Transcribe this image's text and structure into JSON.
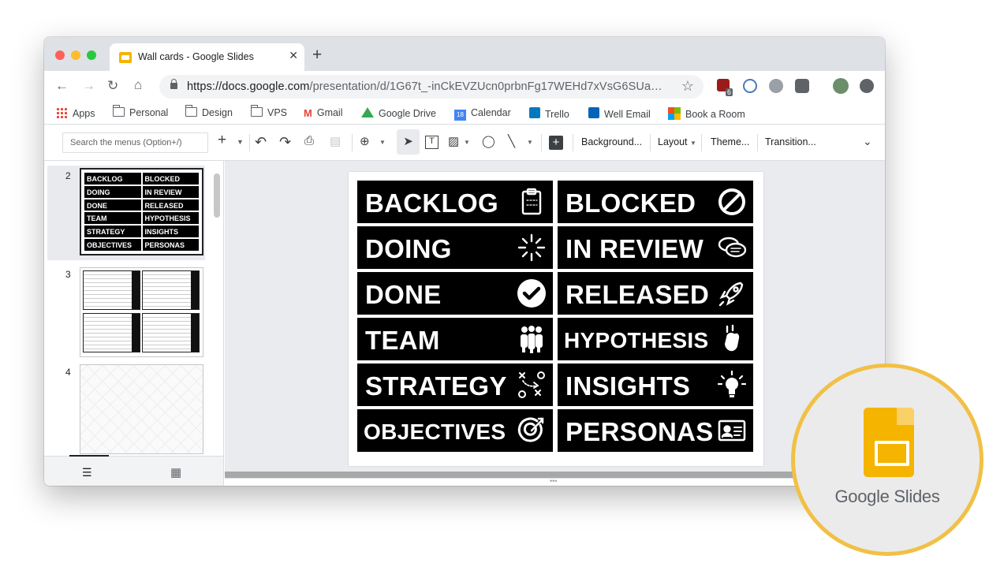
{
  "browser": {
    "tab_title": "Wall cards - Google Slides",
    "tab_close": "✕",
    "new_tab": "+",
    "url_host": "https://docs.google.com",
    "url_path": "/presentation/d/1G67t_-inCkEVZUcn0prbnFg17WEHd7xVsG6SUa…",
    "ext_badge": "6",
    "bookmarks": [
      "Apps",
      "Personal",
      "Design",
      "VPS",
      "Gmail",
      "Google Drive",
      "Calendar",
      "Trello",
      "Well Email",
      "Book a Room"
    ],
    "calendar_day": "18"
  },
  "slides_toolbar": {
    "search_menus": "Search the menus (Option+/)",
    "background": "Background...",
    "layout": "Layout",
    "theme": "Theme...",
    "transition": "Transition..."
  },
  "filmstrip": {
    "slide_numbers": [
      "2",
      "3",
      "4"
    ],
    "slide2_cards": [
      "BACKLOG",
      "BLOCKED",
      "DOING",
      "IN REVIEW",
      "DONE",
      "RELEASED",
      "TEAM",
      "HYPOTHESIS",
      "STRATEGY",
      "INSIGHTS",
      "OBJECTIVES",
      "PERSONAS"
    ]
  },
  "slide": {
    "cards": [
      {
        "label": "BACKLOG",
        "icon": "clipboard-icon"
      },
      {
        "label": "BLOCKED",
        "icon": "blocked-icon"
      },
      {
        "label": "DOING",
        "icon": "spinner-icon"
      },
      {
        "label": "IN REVIEW",
        "icon": "chat-bubbles-icon"
      },
      {
        "label": "DONE",
        "icon": "check-circle-icon"
      },
      {
        "label": "RELEASED",
        "icon": "rocket-icon"
      },
      {
        "label": "TEAM",
        "icon": "people-icon"
      },
      {
        "label": "HYPOTHESIS",
        "icon": "raised-hand-icon"
      },
      {
        "label": "STRATEGY",
        "icon": "strategy-icon"
      },
      {
        "label": "INSIGHTS",
        "icon": "lightbulb-icon"
      },
      {
        "label": "OBJECTIVES",
        "icon": "target-icon"
      },
      {
        "label": "PERSONAS",
        "icon": "id-card-icon"
      }
    ]
  },
  "badge": {
    "label": "Google Slides"
  },
  "colors": {
    "accent": "#f4b400",
    "badge_ring": "#f1c045"
  }
}
